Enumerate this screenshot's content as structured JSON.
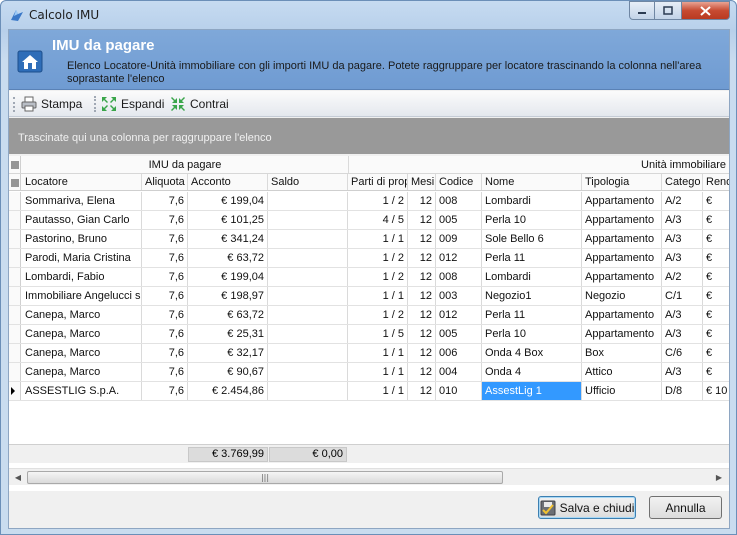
{
  "window": {
    "title": "Calcolo IMU"
  },
  "header": {
    "title": "IMU da pagare",
    "description": "Elenco Locatore-Unità immobiliare con gli importi IMU da pagare. Potete raggruppare per locatore trascinando la colonna nell'area soprastante l'elenco"
  },
  "toolbar": {
    "print": "Stampa",
    "expand": "Espandi",
    "collapse": "Contrai"
  },
  "group_panel": {
    "hint": "Trascinate qui una colonna per raggruppare l'elenco"
  },
  "bands": {
    "imu": "IMU da pagare",
    "unit": "Unità immobiliare"
  },
  "columns": [
    "Locatore",
    "Aliquota",
    "Acconto",
    "Saldo",
    "Parti di prop",
    "Mesi",
    "Codice",
    "Nome",
    "Tipologia",
    "Catego",
    "Rend"
  ],
  "rows": [
    [
      "Sommariva, Elena",
      "7,6",
      "€ 199,04",
      "",
      "1 / 2",
      "12",
      "008",
      "Lombardi",
      "Appartamento",
      "A/2",
      "€"
    ],
    [
      "Pautasso, Gian Carlo",
      "7,6",
      "€ 101,25",
      "",
      "4 / 5",
      "12",
      "005",
      "Perla 10",
      "Appartamento",
      "A/3",
      "€"
    ],
    [
      "Pastorino, Bruno",
      "7,6",
      "€ 341,24",
      "",
      "1 / 1",
      "12",
      "009",
      "Sole Bello 6",
      "Appartamento",
      "A/3",
      "€"
    ],
    [
      "Parodi, Maria Cristina",
      "7,6",
      "€ 63,72",
      "",
      "1 / 2",
      "12",
      "012",
      "Perla 11",
      "Appartamento",
      "A/3",
      "€"
    ],
    [
      "Lombardi, Fabio",
      "7,6",
      "€ 199,04",
      "",
      "1 / 2",
      "12",
      "008",
      "Lombardi",
      "Appartamento",
      "A/2",
      "€"
    ],
    [
      "Immobiliare Angelucci s.r",
      "7,6",
      "€ 198,97",
      "",
      "1 / 1",
      "12",
      "003",
      "Negozio1",
      "Negozio",
      "C/1",
      "€"
    ],
    [
      "Canepa, Marco",
      "7,6",
      "€ 63,72",
      "",
      "1 / 2",
      "12",
      "012",
      "Perla 11",
      "Appartamento",
      "A/3",
      "€"
    ],
    [
      "Canepa, Marco",
      "7,6",
      "€ 25,31",
      "",
      "1 / 5",
      "12",
      "005",
      "Perla 10",
      "Appartamento",
      "A/3",
      "€"
    ],
    [
      "Canepa, Marco",
      "7,6",
      "€ 32,17",
      "",
      "1 / 1",
      "12",
      "006",
      "Onda 4 Box",
      "Box",
      "C/6",
      "€"
    ],
    [
      "Canepa, Marco",
      "7,6",
      "€ 90,67",
      "",
      "1 / 1",
      "12",
      "004",
      "Onda 4",
      "Attico",
      "A/3",
      "€"
    ],
    [
      "ASSESTLIG S.p.A.",
      "7,6",
      "€ 2.454,86",
      "",
      "1 / 1",
      "12",
      "010",
      "AssestLig 1",
      "Ufficio",
      "D/8",
      "€ 10"
    ]
  ],
  "totals": {
    "acconto": "€ 3.769,99",
    "saldo": "€ 0,00"
  },
  "buttons": {
    "save": "Salva e chiudi",
    "cancel": "Annulla"
  }
}
